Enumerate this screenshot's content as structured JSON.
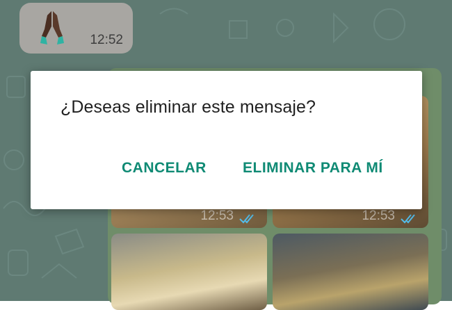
{
  "chat": {
    "received_message": {
      "emoji": "🙏🏿",
      "time": "12:52"
    },
    "photos": [
      {
        "time": "12:53",
        "status": "read"
      },
      {
        "time": "12:53",
        "status": "read"
      },
      {
        "time": "",
        "status": ""
      },
      {
        "time": "",
        "status": ""
      }
    ]
  },
  "dialog": {
    "title": "¿Deseas eliminar este mensaje?",
    "cancel_label": "CANCELAR",
    "delete_label": "ELIMINAR PARA MÍ"
  },
  "colors": {
    "accent": "#0f8a74",
    "chat_background": "#5f7a72",
    "read_ticks": "#53bdeb"
  },
  "icons": {
    "emoji": "folded-hands-emoji-dark-skin",
    "read_receipt": "double-check-icon"
  }
}
